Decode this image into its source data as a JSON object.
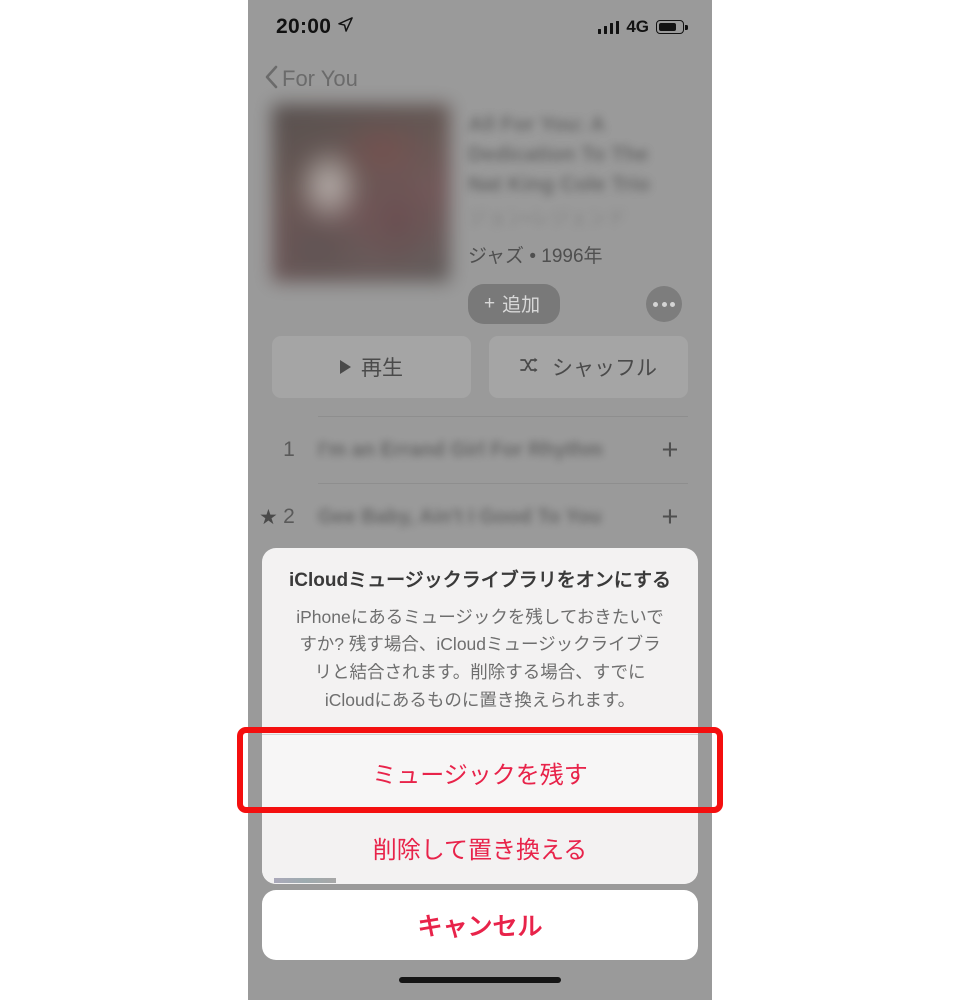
{
  "status_bar": {
    "time": "20:00",
    "location_icon": "location-arrow-icon",
    "signal_icon": "cellular-signal-icon",
    "network": "4G",
    "battery_icon": "battery-icon"
  },
  "nav_bar": {
    "back_icon": "chevron-left-icon",
    "back_label": "For You"
  },
  "album": {
    "artwork_alt": "album-artwork",
    "title": "All For You: A Dedication To The Nat King Cole Trio",
    "artist": "ジョン・レジェンド",
    "genre_year": "ジャズ • 1996年",
    "add_label": "追加",
    "add_icon": "plus-icon",
    "more_icon": "ellipsis-icon"
  },
  "transport": {
    "play_label": "再生",
    "play_icon": "play-triangle-icon",
    "shuffle_label": "シャッフル",
    "shuffle_icon": "shuffle-icon"
  },
  "tracks": [
    {
      "number": "1",
      "name": "I'm an Errand Girl For Rhythm",
      "starred": false,
      "add_icon": "plus-icon"
    },
    {
      "number": "2",
      "name": "Gee Baby, Ain't I Good To You",
      "starred": true,
      "add_icon": "plus-icon"
    }
  ],
  "sheet": {
    "title": "iCloudミュージックライブラリをオンにする",
    "message": "iPhoneにあるミュージックを残しておきたいですか? 残す場合、iCloudミュージックライブラリと結合されます。削除する場合、すでにiCloudにあるものに置き換えられます。",
    "actions": [
      {
        "label": "ミュージックを残す",
        "highlighted": true
      },
      {
        "label": "削除して置き換える",
        "highlighted": false
      }
    ],
    "cancel_label": "キャンセル"
  },
  "annotation": {
    "highlight_color": "#f40f0f",
    "target": "ミュージックを残す"
  },
  "colors": {
    "accent_red": "#e8234a",
    "annotation_red": "#f40f0f",
    "dimmed_background": "#9a9a9a",
    "sheet_background": "#f3f2f2"
  }
}
